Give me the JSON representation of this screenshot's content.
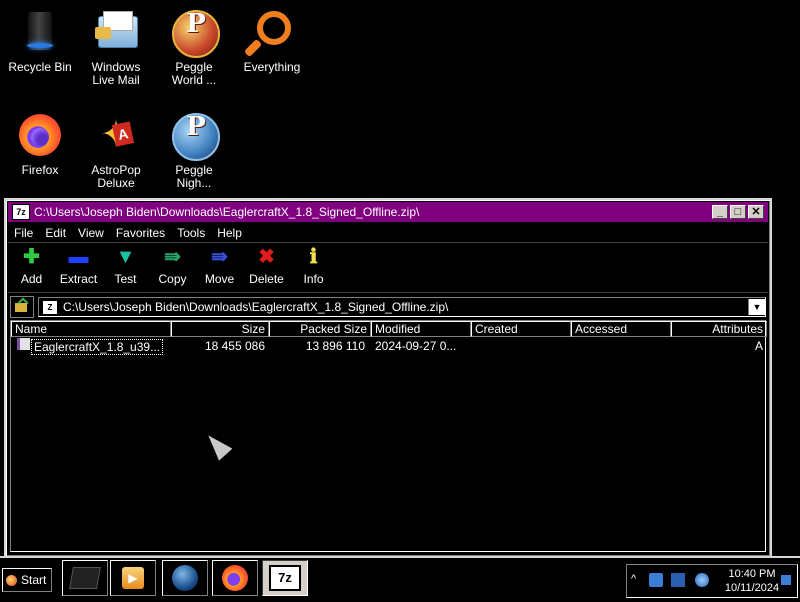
{
  "desktop": {
    "icons": [
      {
        "label": "Recycle Bin",
        "icon": "recycle-bin-icon"
      },
      {
        "label": "Windows Live Mail",
        "icon": "mail-icon"
      },
      {
        "label": "Peggle World ...",
        "icon": "peggle-icon"
      },
      {
        "label": "Everything",
        "icon": "magnifier-icon"
      },
      {
        "label": "Firefox",
        "icon": "firefox-icon"
      },
      {
        "label": "AstroPop Deluxe",
        "icon": "astropop-icon"
      },
      {
        "label": "Peggle Nigh...",
        "icon": "peggle-nights-icon"
      }
    ]
  },
  "window": {
    "title": "C:\\Users\\Joseph Biden\\Downloads\\EaglercraftX_1.8_Signed_Offline.zip\\",
    "app_icon_text": "7z",
    "controls": {
      "minimize": "_",
      "maximize": "□",
      "close": "✕"
    },
    "menu": [
      "File",
      "Edit",
      "View",
      "Favorites",
      "Tools",
      "Help"
    ],
    "toolbar": [
      {
        "label": "Add",
        "glyph": "✚",
        "color": "#2ecc40"
      },
      {
        "label": "Extract",
        "glyph": "▬",
        "color": "#1e40ff"
      },
      {
        "label": "Test",
        "glyph": "▼",
        "color": "#19c2a0"
      },
      {
        "label": "Copy",
        "glyph": "⇛",
        "color": "#2aa36b"
      },
      {
        "label": "Move",
        "glyph": "⇛",
        "color": "#3a4fe0"
      },
      {
        "label": "Delete",
        "glyph": "✖",
        "color": "#e01b1b"
      },
      {
        "label": "Info",
        "glyph": "ℹ",
        "color": "#f4e04d"
      }
    ],
    "address": {
      "path": "C:\\Users\\Joseph Biden\\Downloads\\EaglercraftX_1.8_Signed_Offline.zip\\",
      "zip_icon_text": "Z"
    },
    "columns": [
      "Name",
      "Size",
      "Packed Size",
      "Modified",
      "Created",
      "Accessed",
      "Attributes"
    ],
    "rows": [
      {
        "name": "EaglercraftX_1.8_u39...",
        "size": "18 455 086",
        "packed_size": "13 896 110",
        "modified": "2024-09-27 0...",
        "created": "",
        "accessed": "",
        "attributes": "A"
      }
    ]
  },
  "taskbar": {
    "start_label": "Start",
    "apps": [
      {
        "name": "task-view",
        "active": false
      },
      {
        "name": "media-player",
        "active": false
      },
      {
        "name": "globe",
        "active": false
      },
      {
        "name": "firefox",
        "active": false
      },
      {
        "name": "7-zip",
        "active": true,
        "text": "7z"
      }
    ],
    "tray": {
      "chevron": "^",
      "time": "10:40 PM",
      "date": "10/11/2024"
    }
  }
}
